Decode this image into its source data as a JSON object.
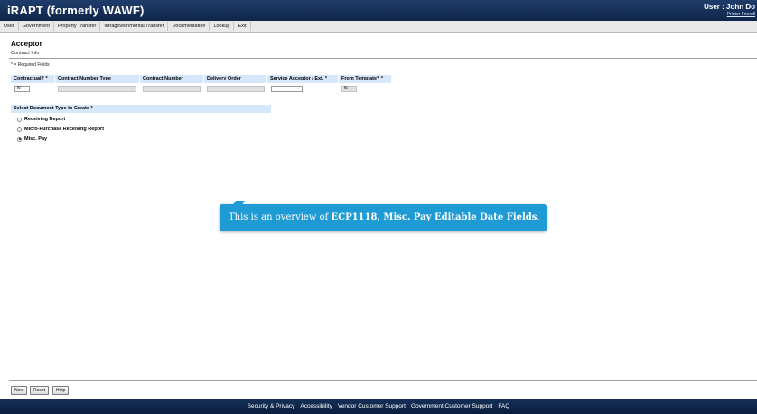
{
  "header": {
    "app_title": "iRAPT (formerly WAWF)",
    "user_label": "User : John Do",
    "printer_link": "Printer Friendl"
  },
  "menu": [
    {
      "label": "User"
    },
    {
      "label": "Government"
    },
    {
      "label": "Property Transfer"
    },
    {
      "label": "Intragovernmental Transfer"
    },
    {
      "label": "Documentation"
    },
    {
      "label": "Lookup"
    },
    {
      "label": "Exit"
    }
  ],
  "page": {
    "title": "Acceptor",
    "subtitle": "Contract Info",
    "required_note": "* = Required Fields"
  },
  "fields": {
    "contractual": {
      "label": "Contractual? *",
      "value": "N"
    },
    "contract_number_type": {
      "label": "Contract Number Type",
      "value": ""
    },
    "contract_number": {
      "label": "Contract Number",
      "value": ""
    },
    "delivery_order": {
      "label": "Delivery Order",
      "value": ""
    },
    "service_acceptor": {
      "label": "Service Acceptor / Ext. *",
      "value": ""
    },
    "from_template": {
      "label": "From Template? *",
      "value": "N"
    }
  },
  "doc_type": {
    "header": "Select Document Type to Create *",
    "options": [
      {
        "label": "Receiving Report",
        "checked": false
      },
      {
        "label": "Micro-Purchase Receiving Report",
        "checked": false
      },
      {
        "label": "Misc. Pay",
        "checked": true
      }
    ]
  },
  "overlay": {
    "prefix": "This is an overview of ",
    "emphasis": "ECP1118, Misc. Pay Editable Date Fields",
    "suffix": "."
  },
  "buttons": {
    "next": "Next",
    "reset": "Reset",
    "help": "Help"
  },
  "footer": [
    {
      "label": "Security & Privacy"
    },
    {
      "label": "Accessibility"
    },
    {
      "label": "Vendor Customer Support"
    },
    {
      "label": "Government Customer Support"
    },
    {
      "label": "FAQ"
    }
  ],
  "colors": {
    "header_bg": "#0f2649",
    "section_header_bg": "#d7e7fb",
    "overlay_bg": "#1e9ad4"
  }
}
